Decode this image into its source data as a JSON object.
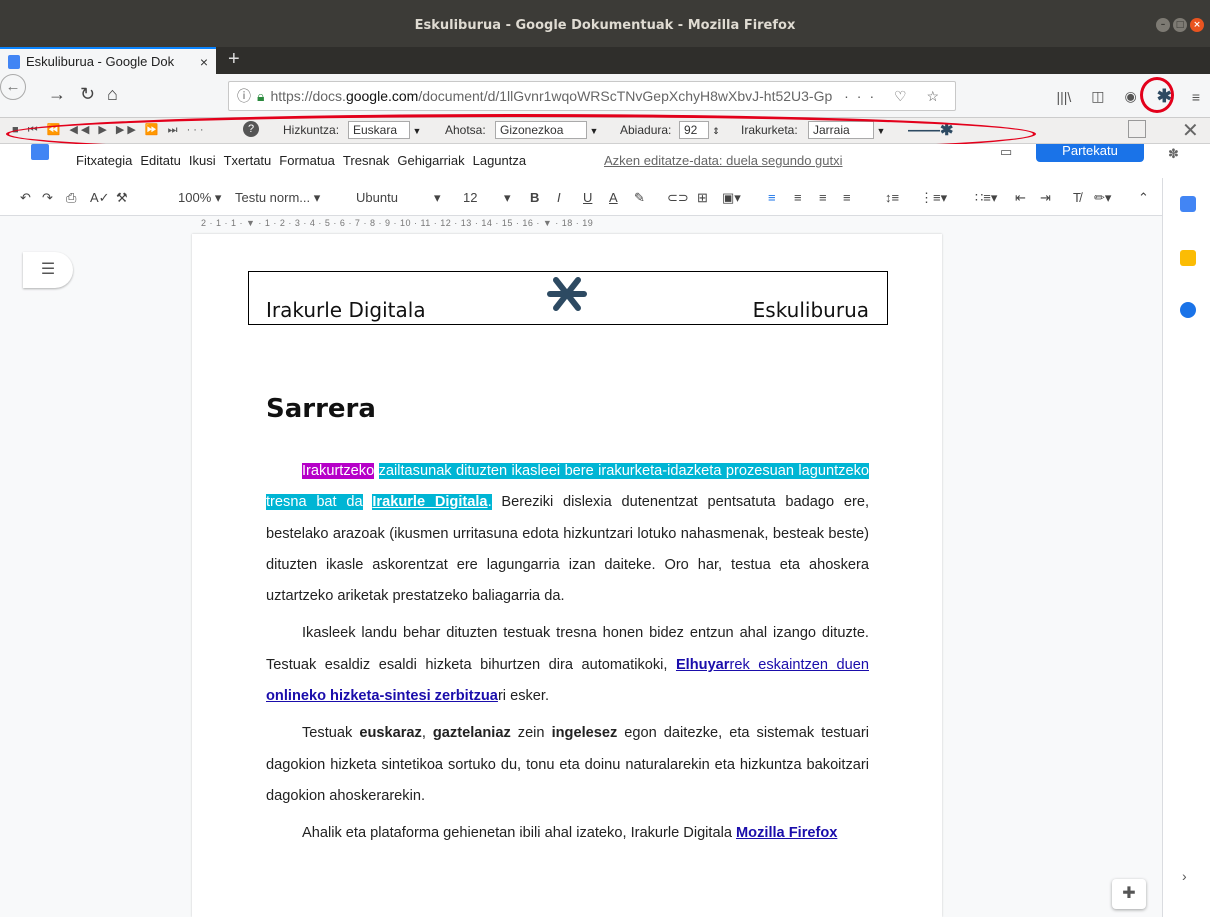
{
  "window": {
    "title": "Eskuliburua - Google Dokumentuak - Mozilla Firefox"
  },
  "tab": {
    "title": "Eskuliburua - Google Dok",
    "close": "×"
  },
  "newtab": "+",
  "nav": {
    "url_prefix": "https://docs.",
    "url_domain": "google.com",
    "url_rest": "/document/d/1llGvnr1wqoWRScTNvGepXchyH8wXbvJ-ht52U3-Gp",
    "page_actions": "··· ♡ ☆"
  },
  "reader": {
    "language_label": "Hizkuntza:",
    "language_value": "Euskara",
    "voice_label": "Ahotsa:",
    "voice_value": "Gizonezkoa",
    "speed_label": "Abiadura:",
    "speed_value": "92",
    "reading_label": "Irakurketa:",
    "reading_value": "Jarraia"
  },
  "docmenu": {
    "items": [
      "Fitxategia",
      "Editatu",
      "Ikusi",
      "Txertatu",
      "Formatua",
      "Tresnak",
      "Gehigarriak",
      "Laguntza"
    ],
    "last_edit": "Azken editatze-data: duela segundo gutxi",
    "share": "Partekatu"
  },
  "toolbar": {
    "zoom": "100%",
    "style": "Testu norm...",
    "font": "Ubuntu",
    "size": "12"
  },
  "ruler": "2 · 1 · 1 · ▼ · 1 · 2 · 3 · 4 · 5 · 6 · 7 · 8 · 9 · 10 · 11 · 12 · 13 · 14 · 15 · 16 · ▼ · 18 · 19",
  "document": {
    "header_left": "Irakurle Digitala",
    "header_right": "Eskuliburua",
    "heading": "Sarrera",
    "p1": {
      "hl1": "Irakurtzeko",
      "hl2": "zailtasunak dituzten ikasleei bere irakurketa-idazketa prozesuan laguntzeko tresna bat da",
      "hl3": "Irakurle Digitala",
      "hl4": ".",
      "rest": " Bereziki dislexia dutenentzat pentsatuta badago ere, bestelako arazoak (ikusmen urritasuna edota hizkuntzari lotuko nahasmenak, besteak beste) dituzten ikasle askorentzat ere lagungarria izan daiteke. Oro har, testua eta ahoskera uztartzeko ariketak prestatzeko baliagarria da."
    },
    "p2": {
      "a": "Ikasleek landu behar dituzten testuak tresna honen bidez entzun ahal izango dituzte. Testuak esaldiz esaldi hizketa bihurtzen dira automatikoki, ",
      "link1": "Elhuyar",
      "link2": "rek eskaintzen duen ",
      "link3": "onlineko hizketa-sintesi zerbitzua",
      "b": "ri esker."
    },
    "p3": {
      "a": "Testuak ",
      "b1": "euskaraz",
      "c": ", ",
      "b2": "gaztelaniaz",
      "d": " zein ",
      "b3": "ingelesez",
      "e": " egon daitezke, eta sistemak testuari dagokion hizketa sintetikoa sortuko du, tonu eta doinu naturalarekin eta hizkuntza bakoitzari dagokion ahoskerarekin."
    },
    "p4": {
      "a": "Ahalik eta plataforma gehienetan ibili ahal izateko, Irakurle Digitala ",
      "link": "Mozilla Firefox"
    }
  }
}
